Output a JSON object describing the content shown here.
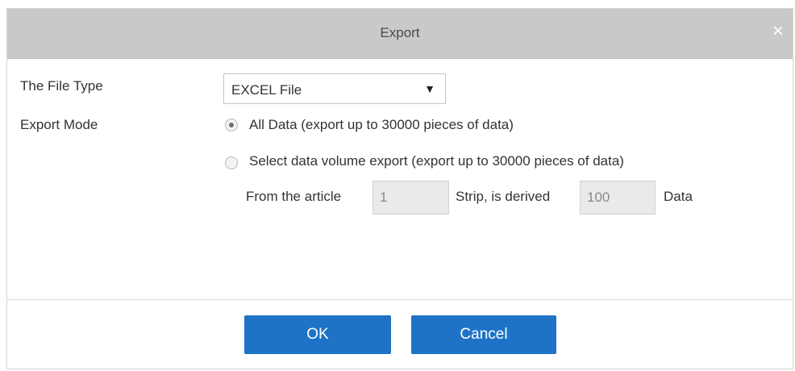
{
  "dialog": {
    "title": "Export",
    "close_glyph": "×"
  },
  "file_type": {
    "label": "The File Type",
    "selected": "EXCEL File",
    "arrow_glyph": "▼"
  },
  "export_mode": {
    "label": "Export Mode",
    "options": [
      {
        "label": "All Data (export up to 30000 pieces of data)",
        "checked": true
      },
      {
        "label": "Select data volume export (export up to 30000 pieces of data)",
        "checked": false
      }
    ]
  },
  "range": {
    "from_label": "From the article",
    "from_value": "1",
    "middle_label": "Strip, is derived",
    "count_value": "100",
    "suffix_label": "Data"
  },
  "buttons": {
    "ok": "OK",
    "cancel": "Cancel"
  },
  "colors": {
    "titlebar": "#c9c9c9",
    "button": "#1f73c7"
  }
}
